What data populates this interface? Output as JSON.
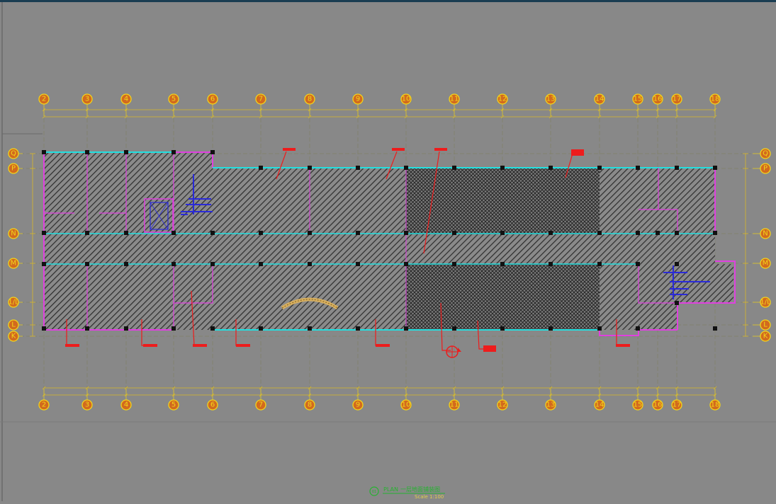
{
  "drawing": {
    "title_prefix": "PLAN",
    "title": "一层地面铺装图",
    "scale": "Scale 1:100",
    "title_symbol": "01",
    "colors": {
      "background": "#888888",
      "grid": "#f2d41a",
      "dimension": "#d8b82a",
      "wall_magenta": "#e040e0",
      "wall_cyan": "#22e0e0",
      "leader_red": "#ee1c1c",
      "stair_blue": "#2a2ad8",
      "hatch": "#2c2c2c"
    }
  },
  "grid": {
    "vertical": [
      {
        "label": "2"
      },
      {
        "label": "3"
      },
      {
        "label": "4"
      },
      {
        "label": "5"
      },
      {
        "label": "6"
      },
      {
        "label": "7"
      },
      {
        "label": "8"
      },
      {
        "label": "9"
      },
      {
        "label": "10"
      },
      {
        "label": "11"
      },
      {
        "label": "12"
      },
      {
        "label": "13"
      },
      {
        "label": "14"
      },
      {
        "label": "15"
      },
      {
        "label": "16"
      },
      {
        "label": "17"
      },
      {
        "label": "18"
      }
    ],
    "horizontal": [
      {
        "label": "Q"
      },
      {
        "label": "P"
      },
      {
        "label": "N"
      },
      {
        "label": "M"
      },
      {
        "label": "1/L"
      },
      {
        "label": "L"
      },
      {
        "label": "K"
      }
    ]
  },
  "tags": [
    {
      "text": "M"
    },
    {
      "text": "M"
    },
    {
      "text": "M"
    },
    {
      "text": "M"
    },
    {
      "text": "M"
    }
  ]
}
